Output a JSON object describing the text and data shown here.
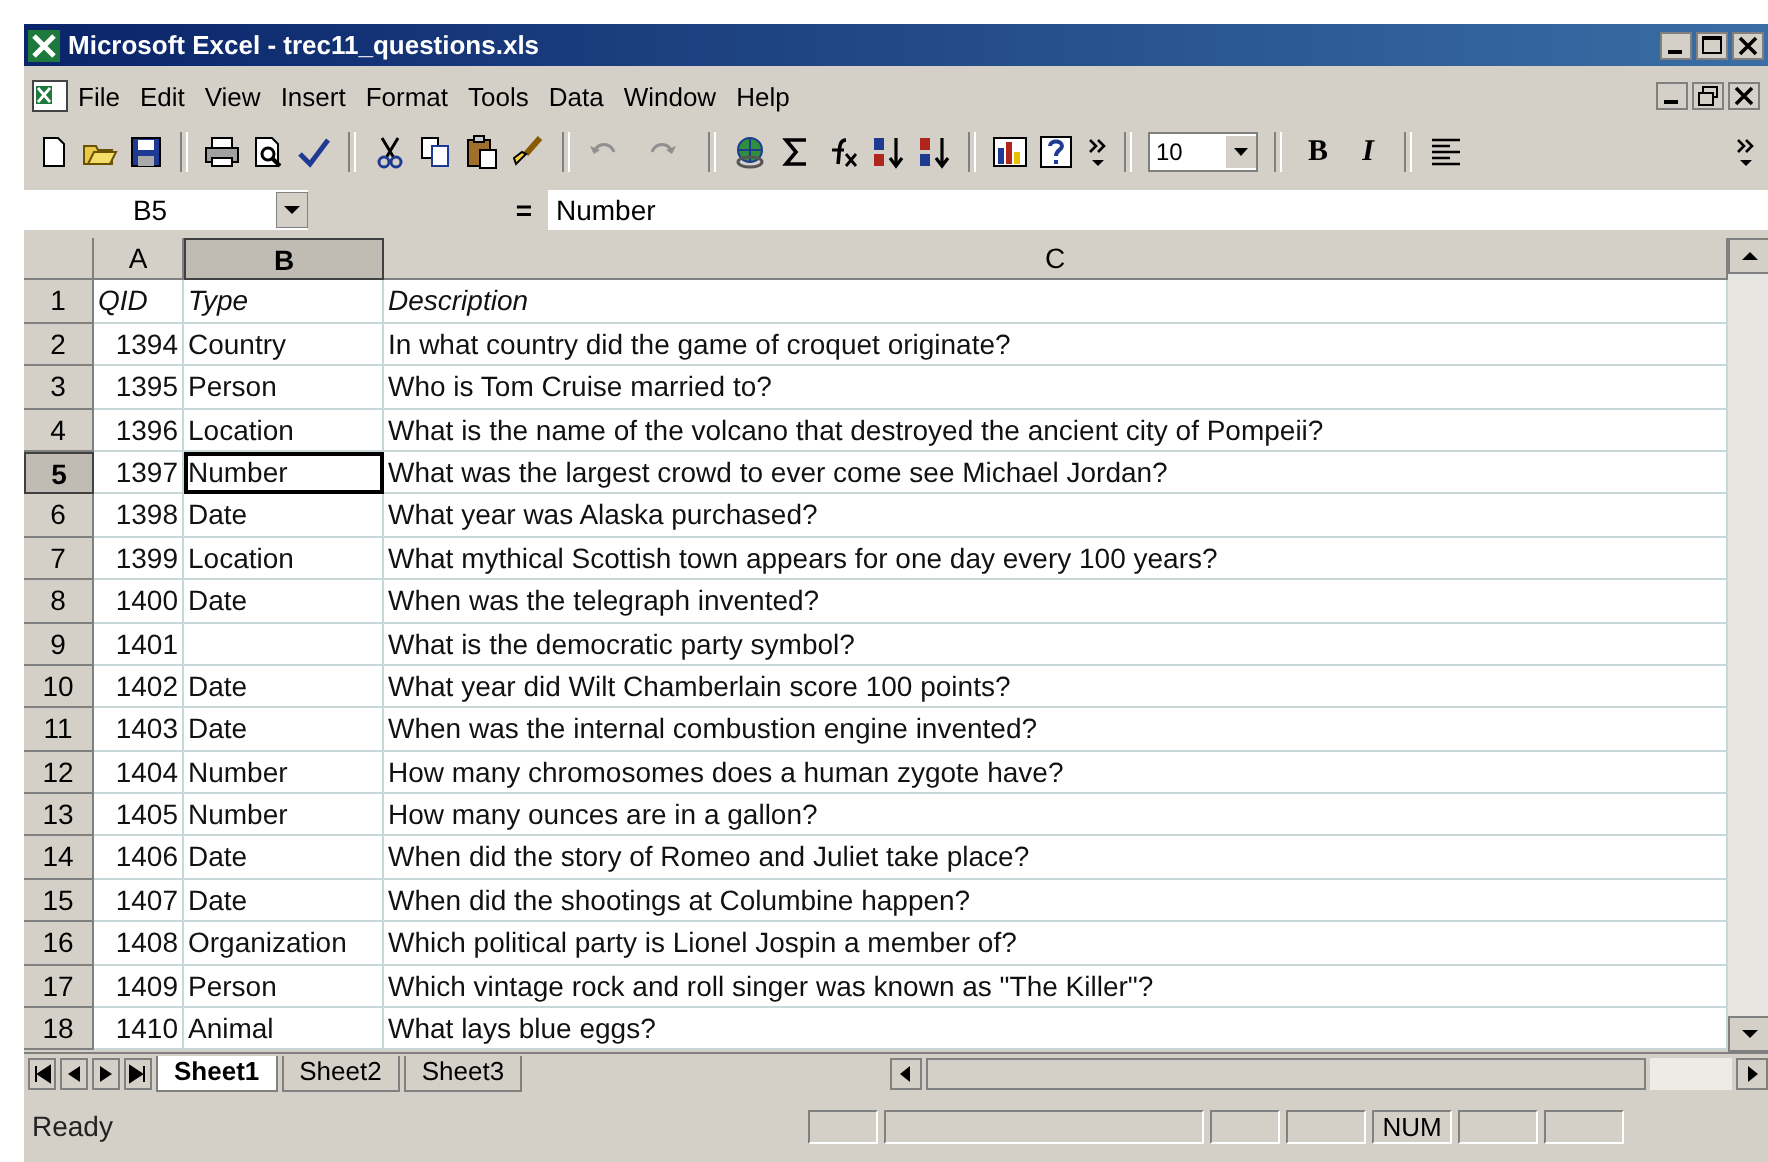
{
  "window": {
    "title": "Microsoft Excel - trec11_questions.xls"
  },
  "menu": [
    "File",
    "Edit",
    "View",
    "Insert",
    "Format",
    "Tools",
    "Data",
    "Window",
    "Help"
  ],
  "toolbar": {
    "font_size": "10",
    "bold": "B",
    "italic": "I"
  },
  "formula_bar": {
    "name_box": "B5",
    "equals": "=",
    "content": "Number"
  },
  "grid": {
    "columns": [
      {
        "label": "A",
        "selected": false
      },
      {
        "label": "B",
        "selected": true
      },
      {
        "label": "C",
        "selected": false
      }
    ],
    "rows": [
      {
        "header": "1",
        "kind": "heading",
        "selected": false,
        "cells": [
          "QID",
          "Type",
          "Description"
        ]
      },
      {
        "header": "2",
        "kind": "data",
        "selected": false,
        "cells": [
          "1394",
          "Country",
          "In what country did the game of croquet originate?"
        ]
      },
      {
        "header": "3",
        "kind": "data",
        "selected": false,
        "cells": [
          "1395",
          "Person",
          "Who is Tom Cruise married to?"
        ]
      },
      {
        "header": "4",
        "kind": "data",
        "selected": false,
        "cells": [
          "1396",
          "Location",
          "What is the name of the volcano that destroyed the ancient city of Pompeii?"
        ]
      },
      {
        "header": "5",
        "kind": "data",
        "selected": true,
        "cells": [
          "1397",
          "Number",
          "What was the largest crowd to ever come see Michael Jordan?"
        ]
      },
      {
        "header": "6",
        "kind": "data",
        "selected": false,
        "cells": [
          "1398",
          "Date",
          "What year was Alaska purchased?"
        ]
      },
      {
        "header": "7",
        "kind": "data",
        "selected": false,
        "cells": [
          "1399",
          "Location",
          "What mythical Scottish town appears for one day every 100 years?"
        ]
      },
      {
        "header": "8",
        "kind": "data",
        "selected": false,
        "cells": [
          "1400",
          "Date",
          "When was the telegraph invented?"
        ]
      },
      {
        "header": "9",
        "kind": "data",
        "selected": false,
        "cells": [
          "1401",
          "",
          "What is the democratic party symbol?"
        ]
      },
      {
        "header": "10",
        "kind": "data",
        "selected": false,
        "cells": [
          "1402",
          "Date",
          "What year did Wilt Chamberlain score 100 points?"
        ]
      },
      {
        "header": "11",
        "kind": "data",
        "selected": false,
        "cells": [
          "1403",
          "Date",
          "When was the internal combustion engine invented?"
        ]
      },
      {
        "header": "12",
        "kind": "data",
        "selected": false,
        "cells": [
          "1404",
          "Number",
          "How many chromosomes does a human zygote have?"
        ]
      },
      {
        "header": "13",
        "kind": "data",
        "selected": false,
        "cells": [
          "1405",
          "Number",
          "How many ounces are in a gallon?"
        ]
      },
      {
        "header": "14",
        "kind": "data",
        "selected": false,
        "cells": [
          "1406",
          "Date",
          "When did the story of Romeo and Juliet take place?"
        ]
      },
      {
        "header": "15",
        "kind": "data",
        "selected": false,
        "cells": [
          "1407",
          "Date",
          "When did the shootings at Columbine happen?"
        ]
      },
      {
        "header": "16",
        "kind": "data",
        "selected": false,
        "cells": [
          "1408",
          "Organization",
          "Which political party is Lionel Jospin a member of?"
        ]
      },
      {
        "header": "17",
        "kind": "data",
        "selected": false,
        "cells": [
          "1409",
          "Person",
          "Which vintage rock and roll singer was known as \"The Killer\"?"
        ]
      },
      {
        "header": "18",
        "kind": "data",
        "selected": false,
        "cells": [
          "1410",
          "Animal",
          "What lays blue eggs?"
        ]
      }
    ]
  },
  "sheet_tabs": [
    {
      "label": "Sheet1",
      "selected": true
    },
    {
      "label": "Sheet2",
      "selected": false
    },
    {
      "label": "Sheet3",
      "selected": false
    }
  ],
  "status_bar": {
    "text": "Ready",
    "indicators": [
      "NUM"
    ]
  }
}
